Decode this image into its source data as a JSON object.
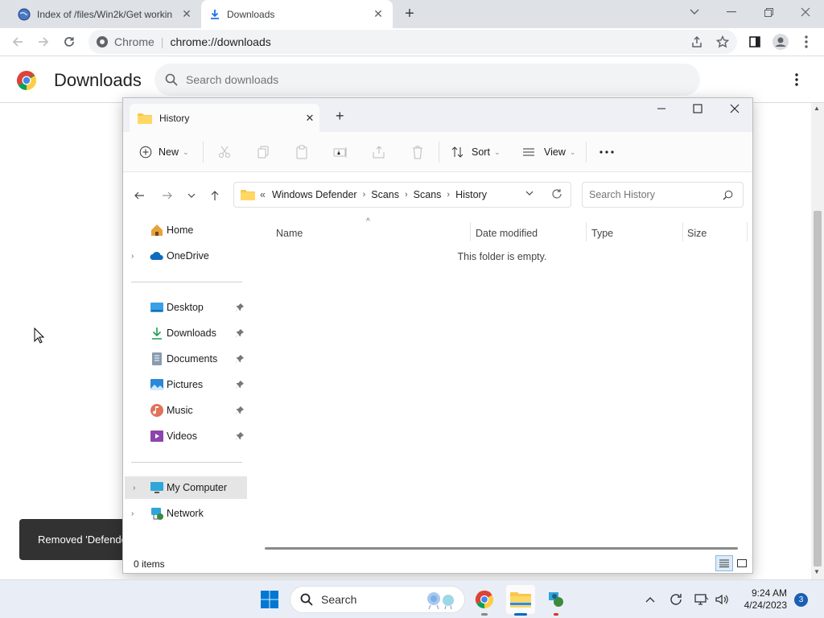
{
  "browser": {
    "tabs": [
      {
        "title": "Index of /files/Win2k/Get workin"
      },
      {
        "title": "Downloads"
      }
    ],
    "address": {
      "chip": "Chrome",
      "url": "chrome://downloads"
    }
  },
  "downloads_page": {
    "title": "Downloads",
    "search_placeholder": "Search downloads",
    "toast": "Removed 'Defende"
  },
  "explorer": {
    "tab_title": "History",
    "commands": {
      "new": "New",
      "sort": "Sort",
      "view": "View"
    },
    "breadcrumb": {
      "prefix": "«",
      "items": [
        "Windows Defender",
        "Scans",
        "Scans",
        "History"
      ]
    },
    "search_placeholder": "Search History",
    "nav": {
      "home": "Home",
      "onedrive": "OneDrive",
      "quick": [
        "Desktop",
        "Downloads",
        "Documents",
        "Pictures",
        "Music",
        "Videos"
      ],
      "my_computer": "My Computer",
      "network": "Network"
    },
    "columns": [
      "Name",
      "Date modified",
      "Type",
      "Size"
    ],
    "empty_message": "This folder is empty.",
    "status": "0 items"
  },
  "taskbar": {
    "search": "Search",
    "time": "9:24 AM",
    "date": "4/24/2023",
    "badge": "3"
  },
  "colors": {
    "accent": "#0067c0",
    "folder": "#f8c74b",
    "chrome_tabbar": "#dee1e6",
    "toast_bg": "#323232"
  }
}
